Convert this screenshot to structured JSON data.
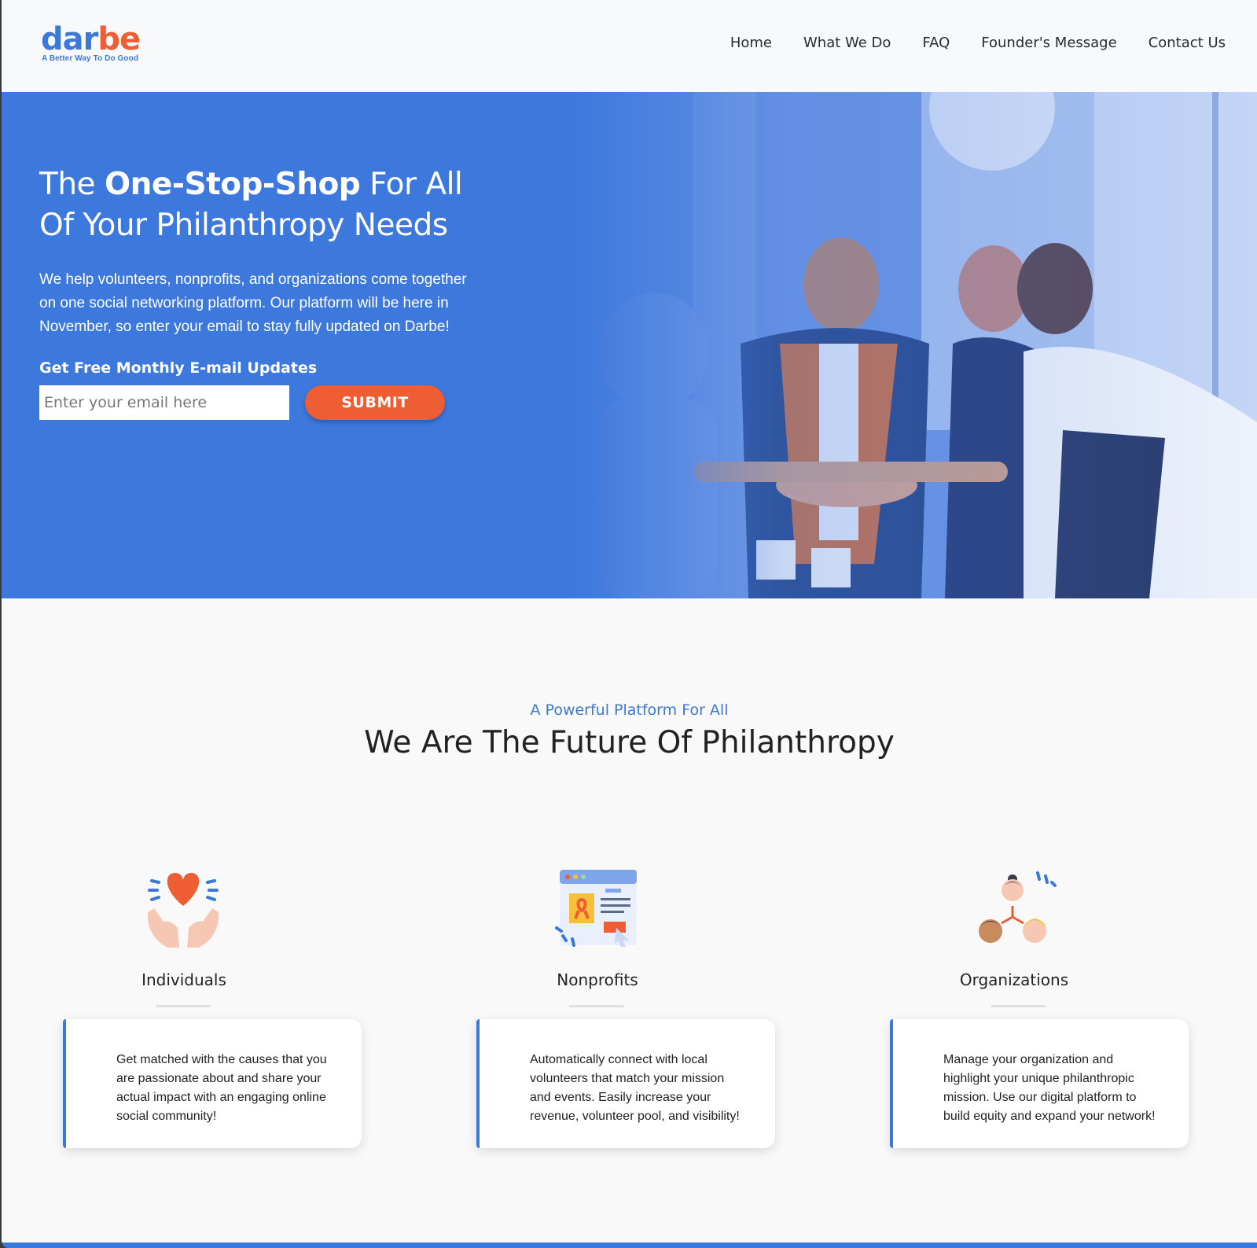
{
  "brand": {
    "logo_part1": "dar",
    "logo_part2": "be",
    "tagline": "A Better Way To Do Good",
    "primary_color": "#3c78d8",
    "accent_color": "#ee5d33"
  },
  "nav": {
    "items": [
      "Home",
      "What We Do",
      "FAQ",
      "Founder's Message",
      "Contact Us"
    ]
  },
  "hero": {
    "title_pre": "The ",
    "title_bold": "One-Stop-Shop",
    "title_post": " For All Of Your Philanthropy Needs",
    "description": "We help volunteers, nonprofits, and organizations come together on one social networking platform. Our platform will be here in November, so enter your email to stay fully updated on Darbe!",
    "updates_label": "Get Free Monthly E-mail Updates",
    "email_placeholder": "Enter your email here",
    "email_value": "",
    "submit_label": "SUBMIT"
  },
  "section": {
    "kicker": "A Powerful Platform For All",
    "title": "We Are The Future Of Philanthropy"
  },
  "features": [
    {
      "title": "Individuals",
      "icon": "heart-hands-icon",
      "text": "Get matched with the causes that you are passionate about and share your actual impact with an engaging online social community!"
    },
    {
      "title": "Nonprofits",
      "icon": "web-ribbon-icon",
      "text": "Automatically connect with local volunteers that match your mission and events. Easily increase your revenue, volunteer pool, and visibility!"
    },
    {
      "title": "Organizations",
      "icon": "people-network-icon",
      "text": "Manage your organization and highlight your unique philanthropic mission. Use our digital platform to build equity and expand your network!"
    }
  ]
}
